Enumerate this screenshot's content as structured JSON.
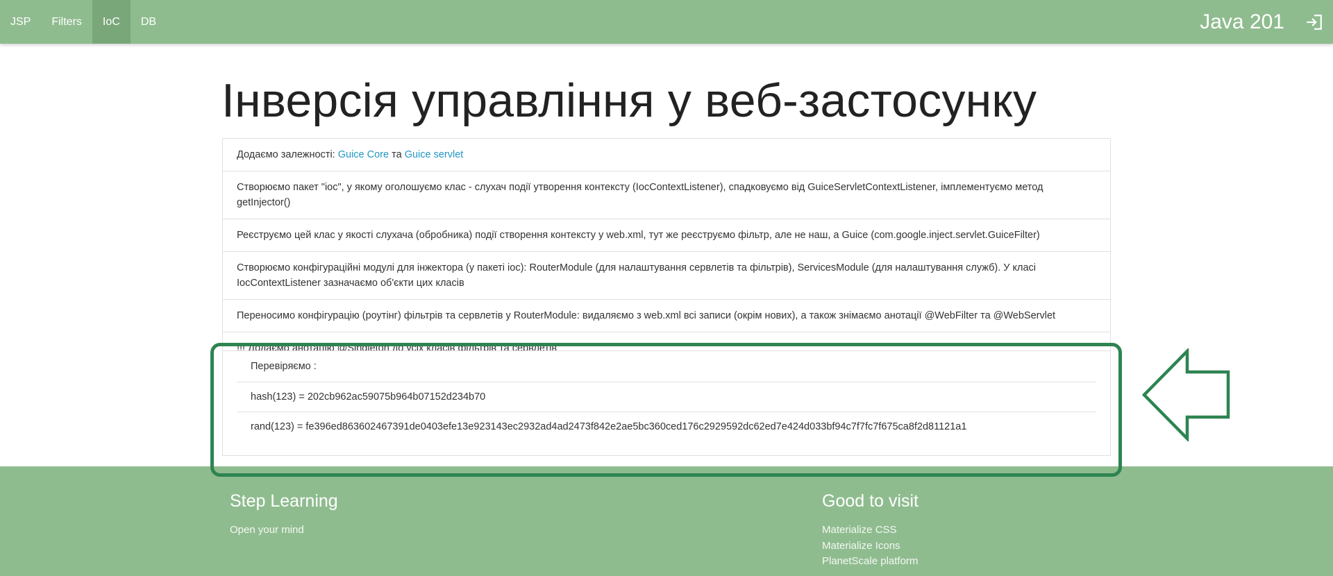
{
  "nav": {
    "links": [
      "JSP",
      "Filters",
      "IoC",
      "DB"
    ],
    "active": "IoC",
    "brand": "Java 201",
    "login_icon": "login-icon"
  },
  "page": {
    "title": "Інверсія управління у веб-застосунку"
  },
  "steps": {
    "item1": {
      "prefix": "Додаємо залежності: ",
      "link1": "Guice Core",
      "conj": " та ",
      "link2": "Guice servlet"
    },
    "item2": "Створюємо пакет \"ioc\", у якому оголошуємо клас - слухач події утворення контексту (IocContextListener), спадковуємо від GuiceServletContextListener, імплементуємо метод getInjector()",
    "item3": "Реєструємо цей клас у якості слухача (обробника) події створення контексту у web.xml, тут же реєструємо фільтр, але не наш, а Guice (com.google.inject.servlet.GuiceFilter)",
    "item4": "Створюємо конфігураційні модулі для інжектора (у пакеті ioc): RouterModule (для налаштування сервлетів та фільтрів), ServicesModule (для налаштування служб). У класі IocContextListener зазначаємо об'єкти цих класів",
    "item5": "Переносимо конфігурацію (роутінг) фільтрів та сервлетів у RouterModule: видаляємо з web.xml всі записи (окрім нових), а також знімаємо анотації @WebFilter та @WebServlet",
    "item6": "!!! Додаємо анотацію @Singleton до усіх класів фільтрів та сервлетів"
  },
  "check": {
    "heading": "Перевіряємо :",
    "hash": "hash(123) = 202cb962ac59075b964b07152d234b70",
    "rand": "rand(123) = fe396ed863602467391de0403efe13e923143ec2932ad4ad2473f842e2ae5bc360ced176c2929592dc62ed7e424d033bf94c7f7fc7f675ca8f2d81121a1"
  },
  "footer": {
    "left": {
      "title": "Step Learning",
      "text": "Open your mind"
    },
    "right": {
      "title": "Good to visit",
      "links": [
        "Materialize CSS",
        "Materialize Icons",
        "PlanetScale platform"
      ]
    }
  },
  "colors": {
    "nav_bg": "#8fbc8f",
    "nav_active": "#7aa77a",
    "link": "#2196c4",
    "highlight": "#2e8451"
  }
}
